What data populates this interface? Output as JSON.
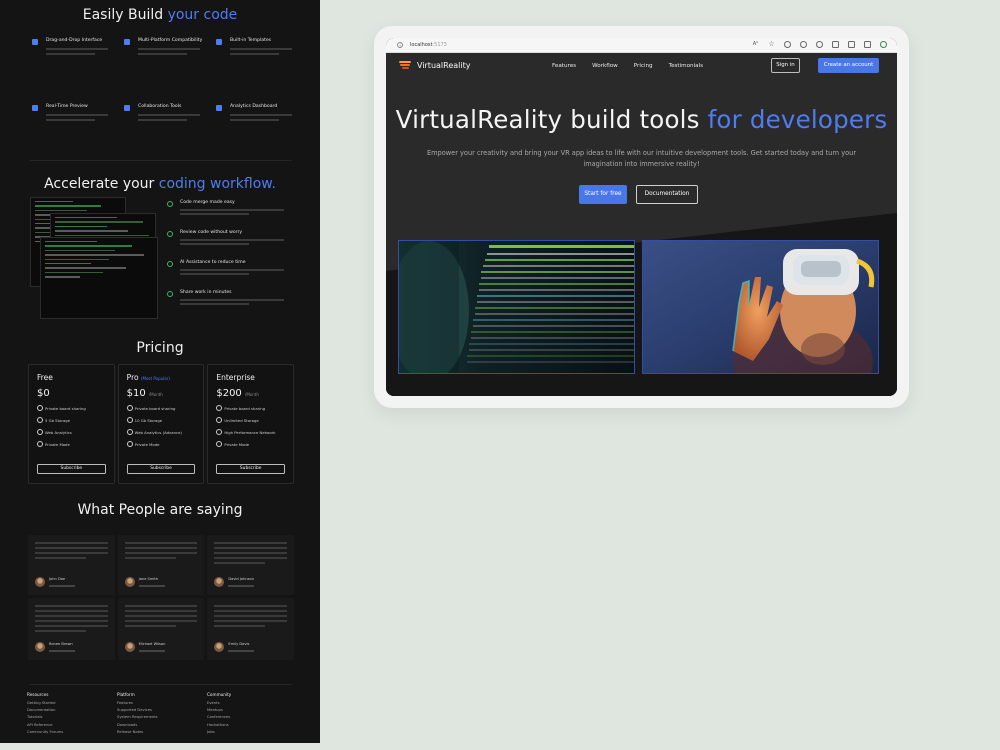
{
  "left_page": {
    "features_title": {
      "plain": "Easily Build ",
      "accent": "your code"
    },
    "features": [
      {
        "title": "Drag-and-Drop Interface"
      },
      {
        "title": "Multi-Platform Compatibility"
      },
      {
        "title": "Built-in Templates"
      },
      {
        "title": "Real-Time Preview"
      },
      {
        "title": "Collaboration Tools"
      },
      {
        "title": "Analytics Dashboard"
      }
    ],
    "workflow_title": {
      "plain": "Accelerate your ",
      "accent": "coding workflow."
    },
    "workflow_items": [
      {
        "title": "Code merge made easy"
      },
      {
        "title": "Review code without worry"
      },
      {
        "title": "AI Assistance to reduce time"
      },
      {
        "title": "Share work in minutes"
      }
    ],
    "pricing_title": "Pricing",
    "plans": [
      {
        "name": "Free",
        "tag": "",
        "price": "$0",
        "period": "",
        "features": [
          "Private board sharing",
          "5 Gb Storage",
          "Web Analytics",
          "Private Mode"
        ],
        "button": "Subscribe"
      },
      {
        "name": "Pro",
        "tag": "(Most Popular)",
        "price": "$10",
        "period": "/Month",
        "features": [
          "Private board sharing",
          "10 Gb Storage",
          "Web Analytics (Advance)",
          "Private Mode"
        ],
        "button": "Subscribe"
      },
      {
        "name": "Enterprise",
        "tag": "",
        "price": "$200",
        "period": "/Month",
        "features": [
          "Private board sharing",
          "Unlimited Storage",
          "High Performance Network",
          "Private Mode"
        ],
        "button": "Subscribe"
      }
    ],
    "testimonials_title": "What People are saying",
    "testimonials": [
      {
        "name": "John Doe"
      },
      {
        "name": "Jane Smith"
      },
      {
        "name": "David Johnson"
      },
      {
        "name": "Ronee Brown"
      },
      {
        "name": "Michael Wilson"
      },
      {
        "name": "Emily Davis"
      }
    ],
    "footer": [
      {
        "heading": "Resources",
        "items": [
          "Getting Started",
          "Documentation",
          "Tutorials",
          "API Reference",
          "Community Forums"
        ]
      },
      {
        "heading": "Platform",
        "items": [
          "Features",
          "Supported Devices",
          "System Requirements",
          "Downloads",
          "Release Notes"
        ]
      },
      {
        "heading": "Community",
        "items": [
          "Events",
          "Meetups",
          "Conferences",
          "Hackathons",
          "Jobs"
        ]
      }
    ]
  },
  "browser": {
    "url_host": "localhost",
    "url_port": ":5173",
    "reader_label": "A⁰"
  },
  "site": {
    "brand": "VirtualReality",
    "nav": [
      "Features",
      "Workflow",
      "Pricing",
      "Testimonials"
    ],
    "signin": "Sign in",
    "create": "Create an account",
    "hero_title_plain": "VirtualReality build tools ",
    "hero_title_accent": "for developers",
    "hero_subtitle": "Empower your creativity and bring your VR app ideas to life with our intuitive development tools. Get started today and turn your imagination into immersive reality!",
    "btn_start": "Start for free",
    "btn_docs": "Documentation"
  },
  "colors": {
    "accent": "#4f7cf0",
    "button": "#4a77e8",
    "page_bg": "#141414",
    "outer_bg": "#dfe6e0"
  }
}
